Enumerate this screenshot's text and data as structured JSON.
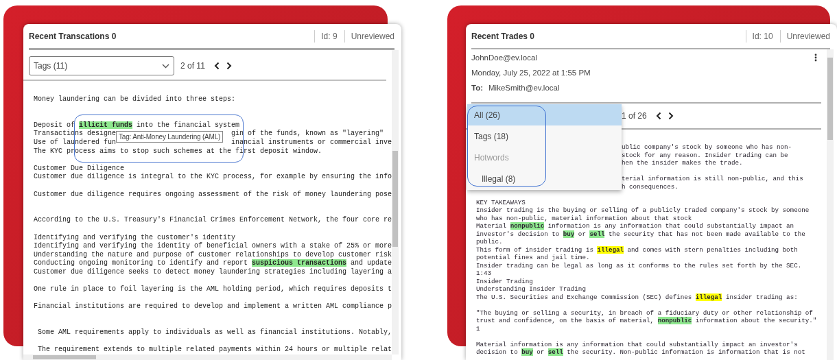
{
  "panels": [
    {
      "title": "Recent Transcations 0",
      "id": "Id: 9",
      "status": "Unreviewed",
      "filter": {
        "value": "Tags (11)",
        "position": "2 of 11"
      },
      "lines": [
        {
          "kind": "text",
          "segments": [
            {
              "text": "Money laundering can be divided into three steps:",
              "kind": "plain"
            }
          ]
        },
        {
          "kind": "blank"
        },
        {
          "kind": "blank"
        },
        {
          "kind": "text",
          "segments": [
            {
              "text": "Deposit of ",
              "kind": "plain"
            },
            {
              "text": "illicit funds",
              "kind": "tag"
            },
            {
              "text": " into the financial system",
              "kind": "plain"
            }
          ]
        },
        {
          "kind": "under_tooltip",
          "segments": [
            {
              "text": "Transactions designe",
              "kind": "plain"
            },
            {
              "text": "Tag: Anti-Money Laundering (AML)",
              "kind": "tooltip"
            },
            {
              "text": "gin of the funds, known as \"layering\"",
              "kind": "plain"
            }
          ]
        },
        {
          "kind": "under_tooltip",
          "segments": [
            {
              "text": "Use of laundered fun",
              "kind": "plain"
            },
            {
              "text": "inancial instruments or commercial inve",
              "kind": "plain"
            }
          ]
        },
        {
          "kind": "text",
          "segments": [
            {
              "text": "The KYC process aims to stop such schemes at the first deposit window.",
              "kind": "plain"
            }
          ]
        },
        {
          "kind": "blank"
        },
        {
          "kind": "text",
          "segments": [
            {
              "text": "Customer Due Diligence",
              "kind": "plain"
            }
          ]
        },
        {
          "kind": "text",
          "segments": [
            {
              "text": "Customer due diligence is integral to the KYC process, for example by ensuring the info",
              "kind": "plain"
            }
          ]
        },
        {
          "kind": "blank"
        },
        {
          "kind": "text",
          "segments": [
            {
              "text": "Customer due diligence requires ongoing assessment of the risk of money laundering pose",
              "kind": "plain"
            }
          ]
        },
        {
          "kind": "blank"
        },
        {
          "kind": "blank"
        },
        {
          "kind": "text",
          "segments": [
            {
              "text": "According to the U.S. Treasury's Financial Crimes Enforcement Network, the four core re",
              "kind": "plain"
            }
          ]
        },
        {
          "kind": "blank"
        },
        {
          "kind": "text",
          "segments": [
            {
              "text": "Identifying and verifying the customer's identity",
              "kind": "plain"
            }
          ]
        },
        {
          "kind": "text",
          "segments": [
            {
              "text": "Identifying and verifying the identity of beneficial owners with a stake of 25% or more",
              "kind": "plain"
            }
          ]
        },
        {
          "kind": "text",
          "segments": [
            {
              "text": "Understanding the nature and purpose of customer relationships to develop customer risk",
              "kind": "plain"
            }
          ]
        },
        {
          "kind": "text",
          "segments": [
            {
              "text": "Conducting ongoing monitoring to identify and report ",
              "kind": "plain"
            },
            {
              "text": "suspicious transactions",
              "kind": "tag"
            },
            {
              "text": " and update",
              "kind": "plain"
            }
          ]
        },
        {
          "kind": "text",
          "segments": [
            {
              "text": "Customer due diligence seeks to detect money laundering strategies including layering a",
              "kind": "plain"
            }
          ]
        },
        {
          "kind": "blank"
        },
        {
          "kind": "text",
          "segments": [
            {
              "text": "One rule in place to foil layering is the AML holding period, which requires deposits t",
              "kind": "plain"
            }
          ]
        },
        {
          "kind": "blank"
        },
        {
          "kind": "text",
          "segments": [
            {
              "text": "Financial institutions are required to develop and implement a written AML compliance p",
              "kind": "plain"
            }
          ]
        },
        {
          "kind": "blank"
        },
        {
          "kind": "blank"
        },
        {
          "kind": "text",
          "segments": [
            {
              "text": " Some AML requirements apply to individuals as well as financial institutions. Notably,",
              "kind": "plain"
            }
          ]
        },
        {
          "kind": "blank"
        },
        {
          "kind": "text",
          "segments": [
            {
              "text": " The requirement extends to multiple related payments within 24 hours or multiple relat",
              "kind": "plain"
            }
          ]
        }
      ]
    },
    {
      "title": "Recent Trades 0",
      "id": "Id: 10",
      "status": "Unreviewed",
      "message": {
        "from": "JohnDoe@ev.local",
        "date": "Monday, July 25, 2022 at 1:55 PM",
        "to_label": "To:",
        "to": "MikeSmith@ev.local"
      },
      "filter": {
        "position": "1 of 26",
        "menu": [
          {
            "label": "All (26)",
            "kind": "option",
            "selected": true
          },
          {
            "label": "Tags (18)",
            "kind": "option",
            "selected": false
          },
          {
            "label": "Hotwords",
            "kind": "group",
            "selected": false
          },
          {
            "label": "Illegal (8)",
            "kind": "suboption",
            "selected": false
          }
        ]
      },
      "lines": [
        {
          "kind": "under_menu",
          "segments": [
            {
              "text": "ublic company's stock by someone who has non-",
              "kind": "plain"
            }
          ]
        },
        {
          "kind": "under_menu",
          "segments": [
            {
              "text": "stock for any reason. Insider trading can be",
              "kind": "plain"
            }
          ]
        },
        {
          "kind": "under_menu",
          "segments": [
            {
              "text": "hen the insider makes the trade.",
              "kind": "plain"
            }
          ]
        },
        {
          "kind": "blank"
        },
        {
          "kind": "under_menu",
          "segments": [
            {
              "text": "terial information is still non-public, and this",
              "kind": "plain"
            }
          ]
        },
        {
          "kind": "under_menu",
          "segments": [
            {
              "text": "h consequences.",
              "kind": "plain"
            }
          ]
        },
        {
          "kind": "blank"
        },
        {
          "kind": "text",
          "segments": [
            {
              "text": "KEY TAKEAWAYS",
              "kind": "plain"
            }
          ]
        },
        {
          "kind": "text",
          "segments": [
            {
              "text": "Insider trading is the buying or selling of a publicly traded company's stock by someone",
              "kind": "plain"
            }
          ]
        },
        {
          "kind": "text",
          "segments": [
            {
              "text": "who has non-public, material information about that stock",
              "kind": "plain"
            }
          ]
        },
        {
          "kind": "text",
          "segments": [
            {
              "text": "Material ",
              "kind": "plain"
            },
            {
              "text": "nonpublic",
              "kind": "tag"
            },
            {
              "text": " information is any information that could substantially impact an",
              "kind": "plain"
            }
          ]
        },
        {
          "kind": "text",
          "segments": [
            {
              "text": "investor's decision to ",
              "kind": "plain"
            },
            {
              "text": "buy",
              "kind": "tag"
            },
            {
              "text": " or ",
              "kind": "plain"
            },
            {
              "text": "sell",
              "kind": "tag"
            },
            {
              "text": " the security that has not been made available to the",
              "kind": "plain"
            }
          ]
        },
        {
          "kind": "text",
          "segments": [
            {
              "text": "public.",
              "kind": "plain"
            }
          ]
        },
        {
          "kind": "text",
          "segments": [
            {
              "text": "This form of insider trading is ",
              "kind": "plain"
            },
            {
              "text": "illegal",
              "kind": "hotword"
            },
            {
              "text": " and comes with stern penalties including both",
              "kind": "plain"
            }
          ]
        },
        {
          "kind": "text",
          "segments": [
            {
              "text": "potential fines and jail time.",
              "kind": "plain"
            }
          ]
        },
        {
          "kind": "text",
          "segments": [
            {
              "text": "Insider trading can be legal as long as it conforms to the rules set forth by the SEC.",
              "kind": "plain"
            }
          ]
        },
        {
          "kind": "text",
          "segments": [
            {
              "text": "1:43",
              "kind": "plain"
            }
          ]
        },
        {
          "kind": "text",
          "segments": [
            {
              "text": "Insider Trading",
              "kind": "plain"
            }
          ]
        },
        {
          "kind": "text",
          "segments": [
            {
              "text": "Understanding Insider Trading",
              "kind": "plain"
            }
          ]
        },
        {
          "kind": "text",
          "segments": [
            {
              "text": "The U.S. Securities and Exchange Commission (SEC) defines ",
              "kind": "plain"
            },
            {
              "text": "illegal",
              "kind": "hotword"
            },
            {
              "text": " insider trading as:",
              "kind": "plain"
            }
          ]
        },
        {
          "kind": "blank"
        },
        {
          "kind": "text",
          "segments": [
            {
              "text": "\"The buying or selling a security, in breach of a fiduciary duty or other relationship of",
              "kind": "plain"
            }
          ]
        },
        {
          "kind": "text",
          "segments": [
            {
              "text": "trust and confidence, on the basis of material, ",
              "kind": "plain"
            },
            {
              "text": "nonpublic",
              "kind": "tag"
            },
            {
              "text": " information about the security.\"",
              "kind": "plain"
            }
          ]
        },
        {
          "kind": "text",
          "segments": [
            {
              "text": "1",
              "kind": "plain"
            }
          ]
        },
        {
          "kind": "blank"
        },
        {
          "kind": "text",
          "segments": [
            {
              "text": "Material information is any information that could substantially impact an investor's",
              "kind": "plain"
            }
          ]
        },
        {
          "kind": "text",
          "segments": [
            {
              "text": "decision to ",
              "kind": "plain"
            },
            {
              "text": "buy",
              "kind": "tag"
            },
            {
              "text": " or ",
              "kind": "plain"
            },
            {
              "text": "sell",
              "kind": "tag"
            },
            {
              "text": " the security. Non-public information is information that is not",
              "kind": "plain"
            }
          ]
        }
      ]
    }
  ]
}
